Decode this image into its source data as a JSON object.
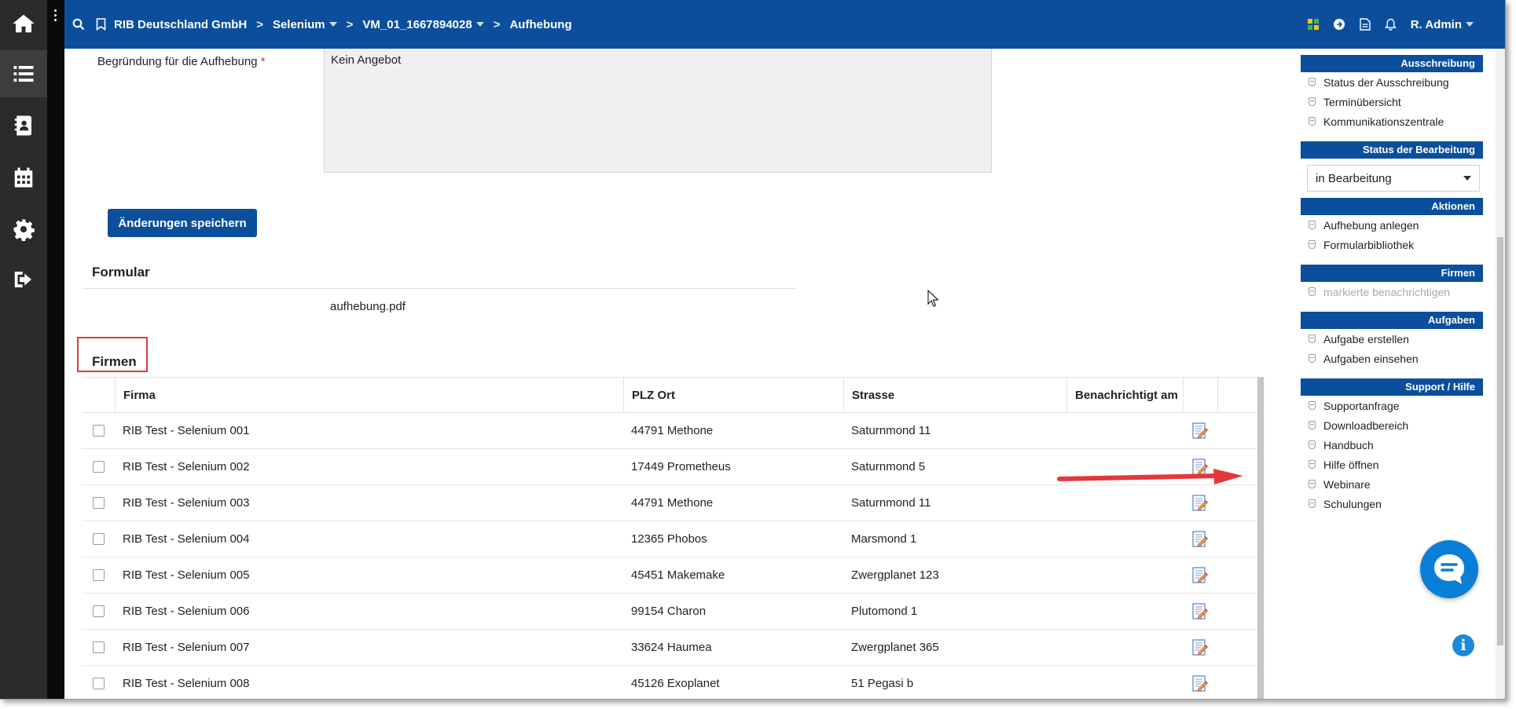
{
  "topbar": {
    "breadcrumbs": [
      {
        "label": "RIB Deutschland GmbH",
        "dropdown": false
      },
      {
        "label": "Selenium",
        "dropdown": true
      },
      {
        "label": "VM_01_1667894028",
        "dropdown": true
      },
      {
        "label": "Aufhebung",
        "dropdown": false
      }
    ],
    "user": "R. Admin"
  },
  "form": {
    "reason_label": "Begründung für die Aufhebung",
    "required_mark": "*",
    "reason_value": "Kein Angebot",
    "save_label": "Änderungen speichern",
    "formular_title": "Formular",
    "formular_file": "aufhebung.pdf"
  },
  "firmen": {
    "title": "Firmen",
    "columns": [
      "Firma",
      "PLZ Ort",
      "Strasse",
      "Benachrichtigt am"
    ],
    "rows": [
      {
        "firma": "RIB Test - Selenium 001",
        "plz_ort": "44791 Methone",
        "strasse": "Saturnmond 11",
        "benachrichtigt": ""
      },
      {
        "firma": "RIB Test - Selenium 002",
        "plz_ort": "17449 Prometheus",
        "strasse": "Saturnmond 5",
        "benachrichtigt": ""
      },
      {
        "firma": "RIB Test - Selenium 003",
        "plz_ort": "44791 Methone",
        "strasse": "Saturnmond 11",
        "benachrichtigt": ""
      },
      {
        "firma": "RIB Test - Selenium 004",
        "plz_ort": "12365 Phobos",
        "strasse": "Marsmond 1",
        "benachrichtigt": ""
      },
      {
        "firma": "RIB Test - Selenium 005",
        "plz_ort": "45451 Makemake",
        "strasse": "Zwergplanet 123",
        "benachrichtigt": ""
      },
      {
        "firma": "RIB Test - Selenium 006",
        "plz_ort": "99154 Charon",
        "strasse": "Plutomond 1",
        "benachrichtigt": ""
      },
      {
        "firma": "RIB Test - Selenium 007",
        "plz_ort": "33624 Haumea",
        "strasse": "Zwergplanet 365",
        "benachrichtigt": ""
      },
      {
        "firma": "RIB Test - Selenium 008",
        "plz_ort": "45126 Exoplanet",
        "strasse": "51 Pegasi b",
        "benachrichtigt": ""
      }
    ]
  },
  "sidebar": {
    "ausschreibung": {
      "title": "Ausschreibung",
      "items": [
        "Status der Ausschreibung",
        "Terminübersicht",
        "Kommunikationszentrale"
      ]
    },
    "status": {
      "title": "Status der Bearbeitung",
      "selected": "in Bearbeitung"
    },
    "aktionen": {
      "title": "Aktionen",
      "items": [
        "Aufhebung anlegen",
        "Formularbibliothek"
      ]
    },
    "firmen": {
      "title": "Firmen",
      "items": [
        "markierte benachrichtigen"
      ]
    },
    "aufgaben": {
      "title": "Aufgaben",
      "items": [
        "Aufgabe erstellen",
        "Aufgaben einsehen"
      ]
    },
    "support": {
      "title": "Support / Hilfe",
      "items": [
        "Supportanfrage",
        "Downloadbereich",
        "Handbuch",
        "Hilfe öffnen",
        "Webinare",
        "Schulungen"
      ]
    }
  },
  "colors": {
    "brand": "#0b4f9c",
    "rail": "#2b2b2b",
    "highlight": "#e03b3b"
  }
}
